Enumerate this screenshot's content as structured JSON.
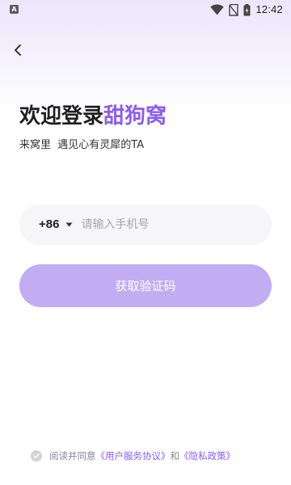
{
  "status_bar": {
    "app_icon_letter": "A",
    "time": "12:42",
    "icons": [
      "wifi-icon",
      "no-sim-icon",
      "battery-icon"
    ]
  },
  "nav": {
    "back_icon": "chevron-left-icon"
  },
  "welcome": {
    "title_prefix": "欢迎登录",
    "brand_name": "甜狗窝",
    "subtitle": "来窝里  遇见心有灵犀的TA"
  },
  "phone": {
    "country_code": "+86",
    "placeholder": "请输入手机号",
    "value": ""
  },
  "actions": {
    "get_code_label": "获取验证码"
  },
  "agreement": {
    "prefix": "阅读并同意",
    "user_agreement": "《用户服务协议》",
    "connector": "和",
    "privacy_policy": "《隐私政策》",
    "checked": false
  },
  "colors": {
    "accent": "#8B5CF6",
    "button_disabled": "#C2ADF2",
    "input_bg": "#F6F6F8",
    "placeholder": "#A5A5AD",
    "header_gradient_top": "#ECE6FB"
  }
}
